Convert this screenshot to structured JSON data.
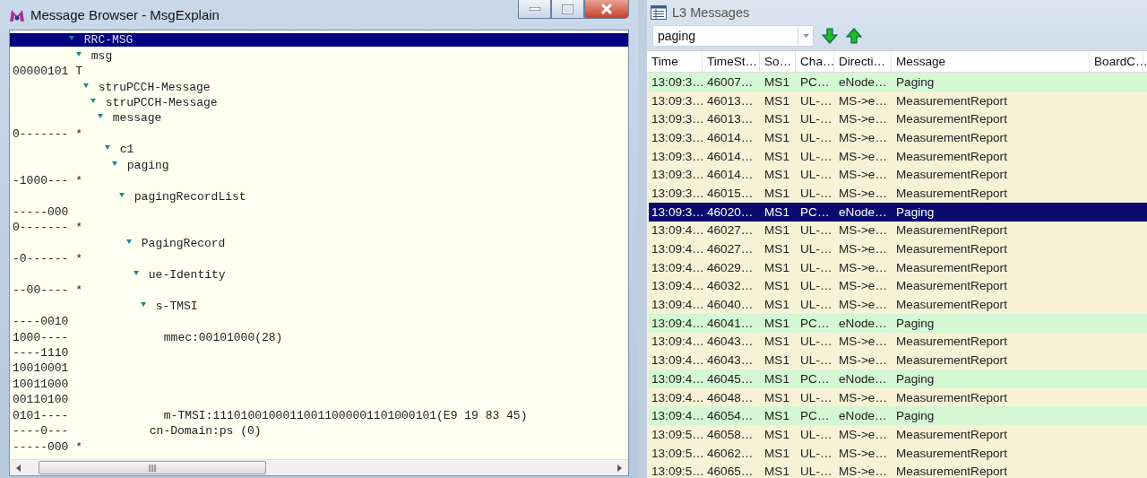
{
  "left_window": {
    "title": "Message Browser - MsgExplain",
    "tree": [
      {
        "kind": "node",
        "label": "RRC-MSG",
        "selected": true,
        "expanded": true,
        "children": [
          {
            "kind": "node",
            "label": "msg",
            "selected": false,
            "expanded": true,
            "children": [
              {
                "kind": "bits",
                "bits": "00000101 T"
              },
              {
                "kind": "node",
                "label": "struPCCH-Message",
                "selected": false,
                "expanded": true,
                "children": [
                  {
                    "kind": "node",
                    "label": "struPCCH-Message",
                    "selected": false,
                    "expanded": true,
                    "children": [
                      {
                        "kind": "node",
                        "label": "message",
                        "selected": false,
                        "expanded": true,
                        "children": [
                          {
                            "kind": "bits",
                            "bits": "0------- *"
                          },
                          {
                            "kind": "node",
                            "label": "c1",
                            "selected": false,
                            "expanded": true,
                            "children": [
                              {
                                "kind": "node",
                                "label": "paging",
                                "selected": false,
                                "expanded": true,
                                "children": [
                                  {
                                    "kind": "bits",
                                    "bits": "-1000--- *"
                                  },
                                  {
                                    "kind": "node",
                                    "label": "pagingRecordList",
                                    "selected": false,
                                    "expanded": true,
                                    "children": [
                                      {
                                        "kind": "bits",
                                        "bits": "-----000"
                                      },
                                      {
                                        "kind": "bits",
                                        "bits": "0------- *"
                                      },
                                      {
                                        "kind": "node",
                                        "label": "PagingRecord",
                                        "selected": false,
                                        "expanded": true,
                                        "children": [
                                          {
                                            "kind": "bits",
                                            "bits": "-0------ *"
                                          },
                                          {
                                            "kind": "node",
                                            "label": "ue-Identity",
                                            "selected": false,
                                            "expanded": true,
                                            "children": [
                                              {
                                                "kind": "bits",
                                                "bits": "--00---- *"
                                              },
                                              {
                                                "kind": "node",
                                                "label": "s-TMSI",
                                                "selected": false,
                                                "expanded": true,
                                                "children": [
                                                  {
                                                    "kind": "bits",
                                                    "bits": "----0010"
                                                  },
                                                  {
                                                    "kind": "node",
                                                    "label": "mmec:00101000(28)",
                                                    "bits": "1000----",
                                                    "selected": false
                                                  },
                                                  {
                                                    "kind": "bits",
                                                    "bits": "----1110"
                                                  },
                                                  {
                                                    "kind": "bits",
                                                    "bits": "10010001"
                                                  },
                                                  {
                                                    "kind": "bits",
                                                    "bits": "10011000"
                                                  },
                                                  {
                                                    "kind": "bits",
                                                    "bits": "00110100"
                                                  },
                                                  {
                                                    "kind": "node",
                                                    "label": "m-TMSI:11101001000110011000001101000101(E9 19 83 45)",
                                                    "bits": "0101----",
                                                    "selected": false
                                                  }
                                                ]
                                              }
                                            ]
                                          },
                                          {
                                            "kind": "node",
                                            "label": "cn-Domain:ps (0)",
                                            "bits": "----0---",
                                            "selected": false
                                          },
                                          {
                                            "kind": "bits",
                                            "bits": "-----000 *"
                                          }
                                        ]
                                      }
                                    ]
                                  }
                                ]
                              }
                            ]
                          }
                        ]
                      }
                    ]
                  }
                ]
              }
            ]
          }
        ]
      }
    ]
  },
  "right_panel": {
    "title": "L3 Messages",
    "search": {
      "value": "paging"
    },
    "table": {
      "columns": [
        "Time",
        "TimeSt…",
        "So…",
        "Cha…",
        "Directi…",
        "Message",
        "BoardC…"
      ],
      "rows": [
        {
          "cells": [
            "13:09:3…",
            "46007…",
            "MS1",
            "PC…",
            "eNode…",
            "Paging"
          ],
          "color": "#d4f7d4",
          "selected": false
        },
        {
          "cells": [
            "13:09:3…",
            "46013…",
            "MS1",
            "UL-…",
            "MS->e…",
            "MeasurementReport"
          ],
          "color": "#f7f1d6",
          "selected": false
        },
        {
          "cells": [
            "13:09:3…",
            "46013…",
            "MS1",
            "UL-…",
            "MS->e…",
            "MeasurementReport"
          ],
          "color": "#f7f1d6",
          "selected": false
        },
        {
          "cells": [
            "13:09:3…",
            "46014…",
            "MS1",
            "UL-…",
            "MS->e…",
            "MeasurementReport"
          ],
          "color": "#f7f1d6",
          "selected": false
        },
        {
          "cells": [
            "13:09:3…",
            "46014…",
            "MS1",
            "UL-…",
            "MS->e…",
            "MeasurementReport"
          ],
          "color": "#f7f1d6",
          "selected": false
        },
        {
          "cells": [
            "13:09:3…",
            "46014…",
            "MS1",
            "UL-…",
            "MS->e…",
            "MeasurementReport"
          ],
          "color": "#f7f1d6",
          "selected": false
        },
        {
          "cells": [
            "13:09:3…",
            "46015…",
            "MS1",
            "UL-…",
            "MS->e…",
            "MeasurementReport"
          ],
          "color": "#f7f1d6",
          "selected": false
        },
        {
          "cells": [
            "13:09:3…",
            "46020…",
            "MS1",
            "PC…",
            "eNode…",
            "Paging"
          ],
          "selected": true
        },
        {
          "cells": [
            "13:09:4…",
            "46027…",
            "MS1",
            "UL-…",
            "MS->e…",
            "MeasurementReport"
          ],
          "color": "#f7f1d6",
          "selected": false
        },
        {
          "cells": [
            "13:09:4…",
            "46027…",
            "MS1",
            "UL-…",
            "MS->e…",
            "MeasurementReport"
          ],
          "color": "#f7f1d6",
          "selected": false
        },
        {
          "cells": [
            "13:09:4…",
            "46029…",
            "MS1",
            "UL-…",
            "MS->e…",
            "MeasurementReport"
          ],
          "color": "#f7f1d6",
          "selected": false
        },
        {
          "cells": [
            "13:09:4…",
            "46032…",
            "MS1",
            "UL-…",
            "MS->e…",
            "MeasurementReport"
          ],
          "color": "#f7f1d6",
          "selected": false
        },
        {
          "cells": [
            "13:09:4…",
            "46040…",
            "MS1",
            "UL-…",
            "MS->e…",
            "MeasurementReport"
          ],
          "color": "#f7f1d6",
          "selected": false
        },
        {
          "cells": [
            "13:09:4…",
            "46041…",
            "MS1",
            "PC…",
            "eNode…",
            "Paging"
          ],
          "color": "#d4f7d4",
          "selected": false
        },
        {
          "cells": [
            "13:09:4…",
            "46043…",
            "MS1",
            "UL-…",
            "MS->e…",
            "MeasurementReport"
          ],
          "color": "#f7f1d6",
          "selected": false
        },
        {
          "cells": [
            "13:09:4…",
            "46043…",
            "MS1",
            "UL-…",
            "MS->e…",
            "MeasurementReport"
          ],
          "color": "#f7f1d6",
          "selected": false
        },
        {
          "cells": [
            "13:09:4…",
            "46045…",
            "MS1",
            "PC…",
            "eNode…",
            "Paging"
          ],
          "color": "#d4f7d4",
          "selected": false
        },
        {
          "cells": [
            "13:09:4…",
            "46048…",
            "MS1",
            "UL-…",
            "MS->e…",
            "MeasurementReport"
          ],
          "color": "#f7f1d6",
          "selected": false
        },
        {
          "cells": [
            "13:09:4…",
            "46054…",
            "MS1",
            "PC…",
            "eNode…",
            "Paging"
          ],
          "color": "#d4f7d4",
          "selected": false
        },
        {
          "cells": [
            "13:09:5…",
            "46058…",
            "MS1",
            "UL-…",
            "MS->e…",
            "MeasurementReport"
          ],
          "color": "#f7f1d6",
          "selected": false
        },
        {
          "cells": [
            "13:09:5…",
            "46062…",
            "MS1",
            "UL-…",
            "MS->e…",
            "MeasurementReport"
          ],
          "color": "#f7f1d6",
          "selected": false
        },
        {
          "cells": [
            "13:09:5…",
            "46065…",
            "MS1",
            "UL-…",
            "MS->e…",
            "MeasurementReport"
          ],
          "color": "#f7f1d6",
          "selected": false
        }
      ]
    }
  }
}
